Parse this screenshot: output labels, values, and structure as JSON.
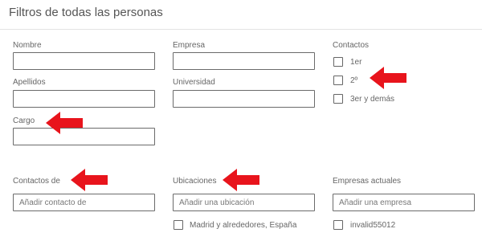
{
  "header": {
    "title": "Filtros de todas las personas"
  },
  "fields": {
    "nombre": {
      "label": "Nombre",
      "value": "",
      "placeholder": ""
    },
    "empresa": {
      "label": "Empresa",
      "value": "",
      "placeholder": ""
    },
    "apellidos": {
      "label": "Apellidos",
      "value": "",
      "placeholder": ""
    },
    "universidad": {
      "label": "Universidad",
      "value": "",
      "placeholder": ""
    },
    "cargo": {
      "label": "Cargo",
      "value": "",
      "placeholder": ""
    },
    "contactos_de": {
      "label": "Contactos de",
      "value": "",
      "placeholder": "Añadir contacto de"
    },
    "ubicaciones": {
      "label": "Ubicaciones",
      "value": "",
      "placeholder": "Añadir una ubicación"
    },
    "empresas_actuales": {
      "label": "Empresas actuales",
      "value": "",
      "placeholder": "Añadir una empresa"
    }
  },
  "contactos": {
    "label": "Contactos",
    "options": [
      {
        "label": "1er",
        "checked": false
      },
      {
        "label": "2º",
        "checked": false
      },
      {
        "label": "3er y demás",
        "checked": false
      }
    ]
  },
  "ubicaciones_options": [
    {
      "label": "Madrid y alrededores, España",
      "checked": false
    }
  ],
  "empresas_options": [
    {
      "label": "invalid55012",
      "checked": false
    }
  ],
  "annotation": {
    "arrow_color": "#e8141c"
  }
}
